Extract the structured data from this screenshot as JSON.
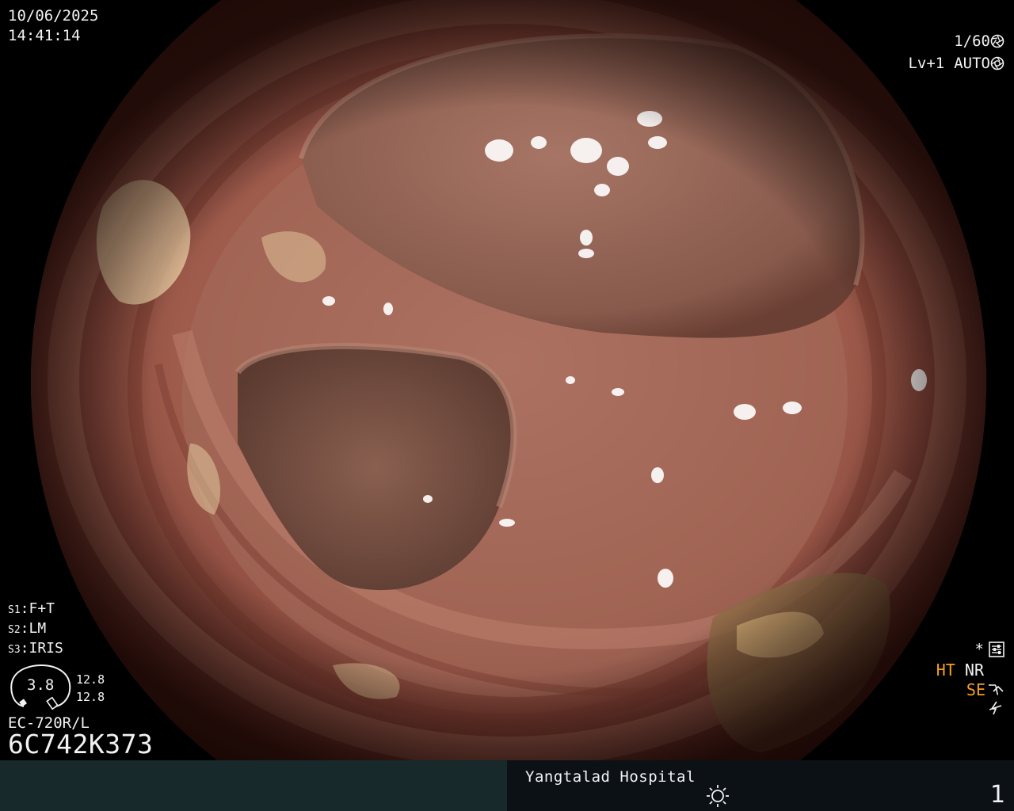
{
  "header": {
    "date": "10/06/2025",
    "time": "14:41:14",
    "shutter": "1/60",
    "level": "Lv+1",
    "mode": "AUTO"
  },
  "settings": {
    "s1_key": "S1",
    "s1_val": "F+T",
    "s2_key": "S2",
    "s2_val": "LM",
    "s3_key": "S3",
    "s3_val": "IRIS"
  },
  "gauge": {
    "value": "3.8",
    "upper": "12.8",
    "lower": "12.8"
  },
  "scope": {
    "model": "EC-720R/L",
    "serial": "6C742K373"
  },
  "status": {
    "star": "*",
    "ht": "HT",
    "nr": "NR",
    "se": "SE"
  },
  "footer": {
    "hospital": "Yangtalad Hospital",
    "page": "1"
  },
  "colors": {
    "accent_orange": "#f5a020",
    "text": "#f2f2f2",
    "bar_left": "#17292a",
    "bar_right": "#0b1115"
  }
}
